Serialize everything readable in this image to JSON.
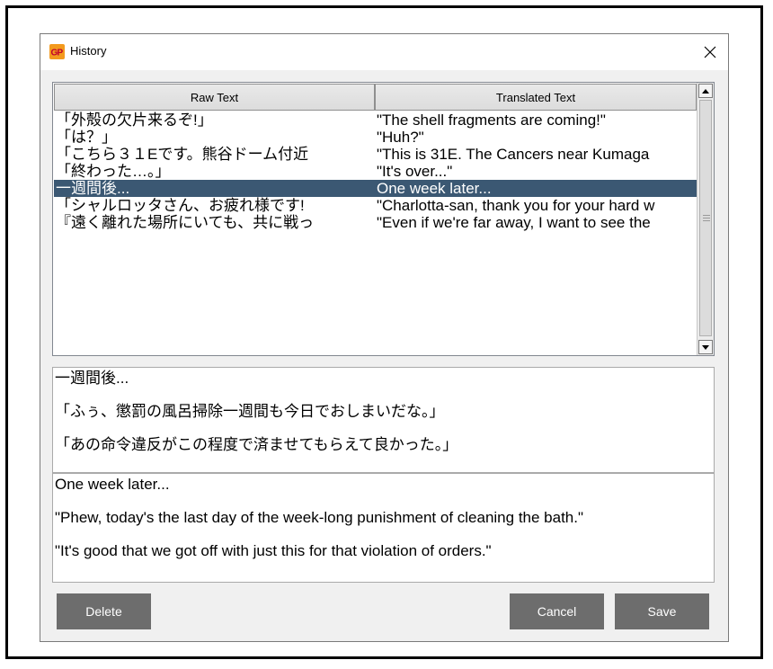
{
  "window": {
    "title": "History",
    "app_icon": "gp-app-icon",
    "close_icon": "close-icon"
  },
  "table": {
    "columns": [
      "Raw Text",
      "Translated Text"
    ],
    "rows": [
      {
        "raw": "「外殻の欠片来るぞ!」",
        "translated": "\"The shell fragments are coming!\""
      },
      {
        "raw": "「は？」",
        "translated": "\"Huh?\""
      },
      {
        "raw": "「こちら３１Eです。熊谷ドーム付近",
        "translated": "\"This is 31E. The Cancers near Kumaga"
      },
      {
        "raw": "「終わった…。」",
        "translated": "\"It's over...\""
      },
      {
        "raw": "一週間後...",
        "translated": "One week later..."
      },
      {
        "raw": "「シャルロッタさん、お疲れ様です!",
        "translated": "\"Charlotta-san, thank you for your hard w"
      },
      {
        "raw": "『遠く離れた場所にいても、共に戦っ",
        "translated": "\"Even if we're far away, I want to see the"
      }
    ],
    "selected_index": 4
  },
  "raw_text": {
    "paragraphs": [
      "一週間後...",
      "「ふぅ、懲罰の風呂掃除一週間も今日でおしまいだな。」",
      "「あの命令違反がこの程度で済ませてもらえて良かった。」"
    ]
  },
  "translated_text": {
    "paragraphs": [
      "One week later...",
      "\"Phew, today's the last day of the week-long punishment of cleaning the bath.\"",
      "\"It's good that we got off with just this for that violation of orders.\""
    ]
  },
  "buttons": {
    "delete": "Delete",
    "cancel": "Cancel",
    "save": "Save"
  },
  "colors": {
    "selected_row": "#3b5873",
    "button_bg": "#6d6d6d",
    "app_icon": "#f39a1e"
  }
}
